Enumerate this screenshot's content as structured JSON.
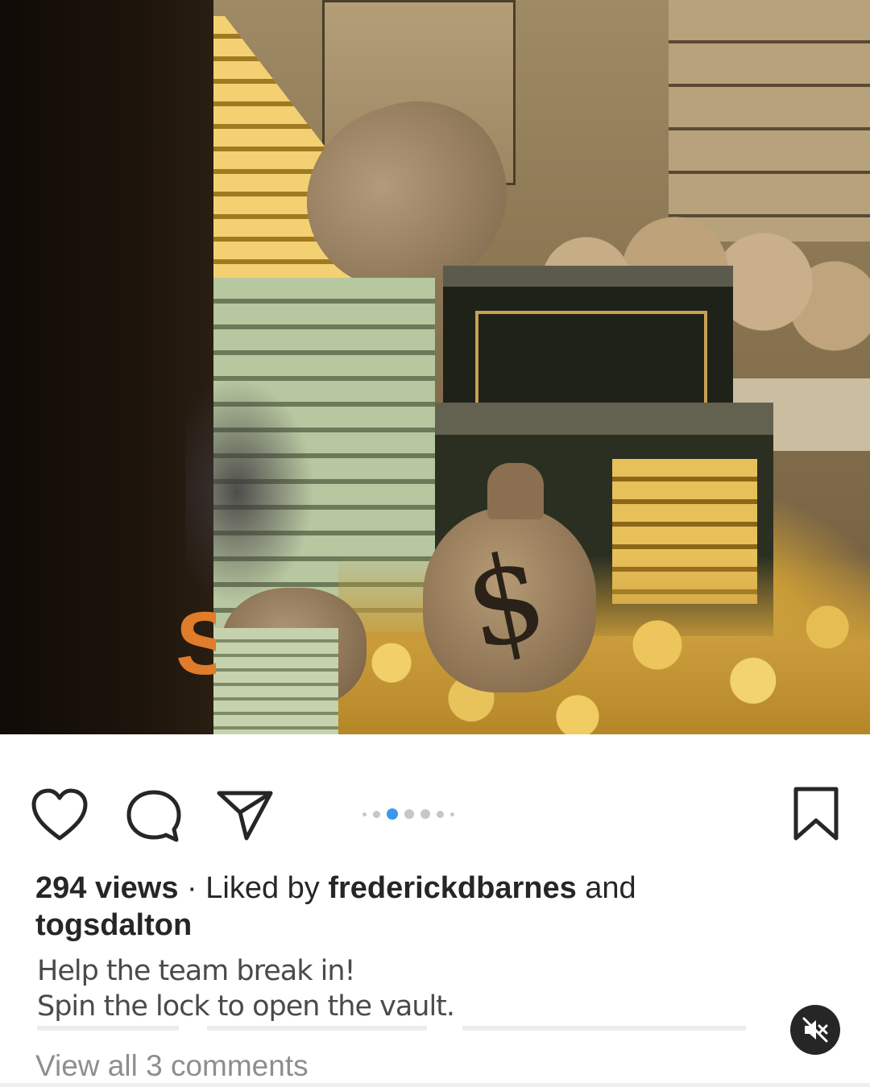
{
  "post": {
    "media": {
      "overlay_letter": "S"
    },
    "actions": {
      "like_icon": "heart-icon",
      "comment_icon": "comment-bubble-icon",
      "share_icon": "paper-plane-icon",
      "save_icon": "bookmark-icon"
    },
    "carousel": {
      "total": 7,
      "active_index": 2,
      "active_color": "#3897f0"
    },
    "views": "294 views",
    "separator": " · ",
    "liked_by_prefix": "Liked by ",
    "liked_user_1": "frederickdbarnes",
    "liked_and": " and",
    "liked_user_2": "togsdalton",
    "caption_line_1": "Help the team break in!",
    "caption_line_2": "Spin the lock to open the vault.",
    "view_comments": "View all 3 comments",
    "mute_icon": "speaker-muted-icon"
  }
}
